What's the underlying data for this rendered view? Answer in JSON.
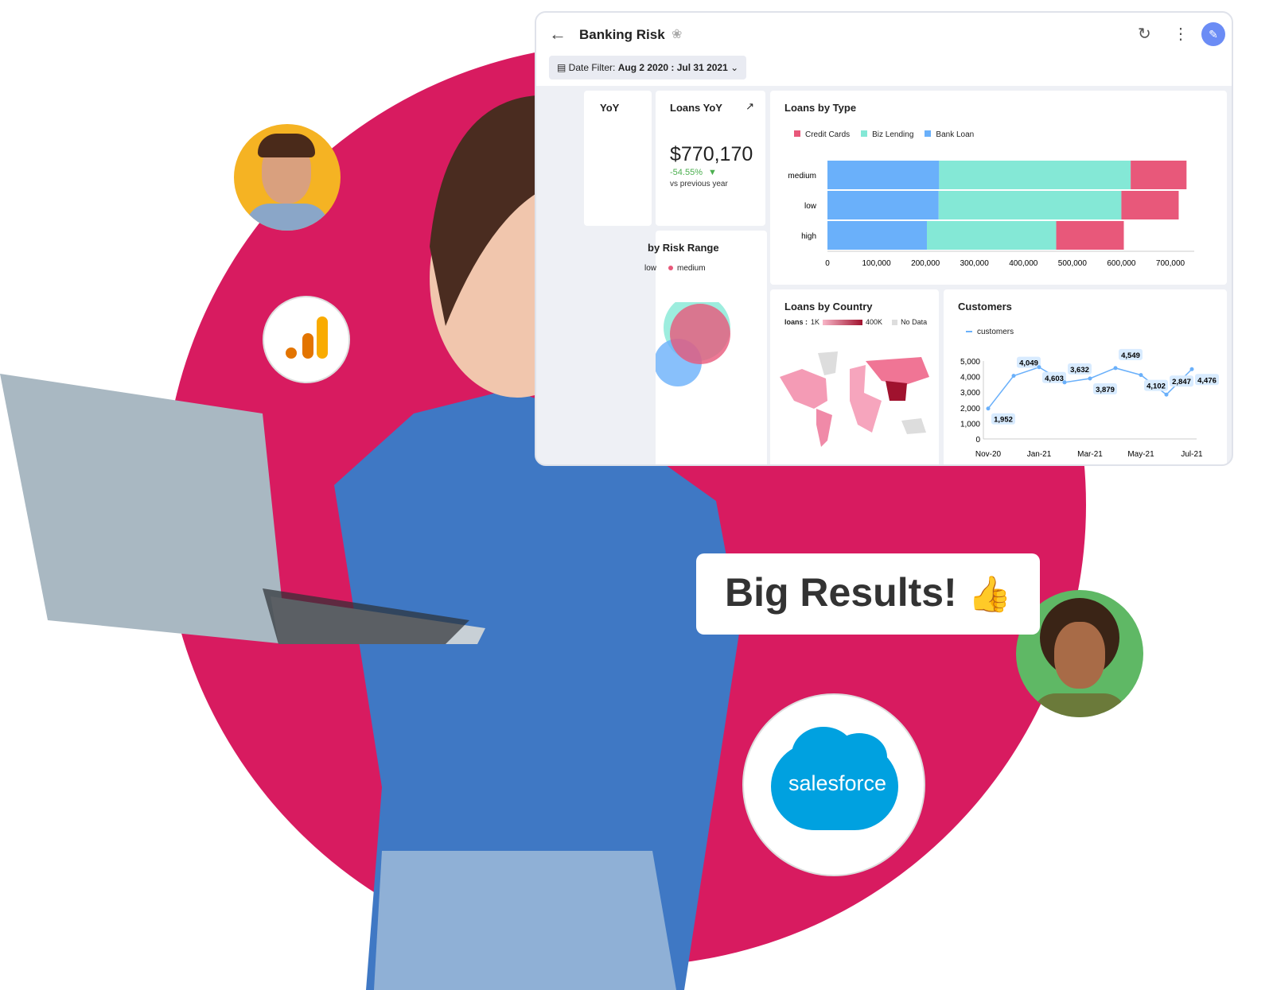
{
  "dashboard": {
    "title": "Banking Risk",
    "filter_label": "Date Filter:",
    "filter_value": "Aug 2 2020 : Jul 31 2021",
    "icons": [
      "back-arrow-icon",
      "badge-icon",
      "refresh-icon",
      "more-vert-icon",
      "edit-pencil-icon"
    ],
    "partial_card_title": "YoY",
    "loans_yoy": {
      "title": "Loans YoY",
      "value": "$770,170",
      "change": "-54.55%",
      "change_color": "#4caf50",
      "caption": "vs previous year"
    },
    "risk_range": {
      "title": "by Risk Range",
      "legend": [
        "low",
        "medium"
      ]
    },
    "map": {
      "title": "Loans by Country",
      "legend_label": "loans :",
      "min": "1K",
      "max": "400K",
      "no_data": "No Data"
    }
  },
  "chart_data": [
    {
      "type": "bar",
      "orientation": "horizontal",
      "stacked": true,
      "title": "Loans by Type",
      "categories": [
        "medium",
        "low",
        "high"
      ],
      "series": [
        {
          "name": "Bank Loan",
          "color": "#6ab0fa",
          "values": [
            228000,
            227000,
            203000
          ]
        },
        {
          "name": "Biz Lending",
          "color": "#84e8d6",
          "values": [
            391000,
            373000,
            264000
          ]
        },
        {
          "name": "Credit Cards",
          "color": "#e8587a",
          "values": [
            114000,
            117000,
            138000
          ]
        }
      ],
      "legend_order": [
        "Credit Cards",
        "Biz Lending",
        "Bank Loan"
      ],
      "xticks": [
        "0",
        "100,000",
        "200,000",
        "300,000",
        "400,000",
        "500,000",
        "600,000",
        "700,000"
      ],
      "xlim": [
        0,
        700000
      ]
    },
    {
      "type": "line",
      "title": "Customers",
      "series": [
        {
          "name": "customers",
          "color": "#6ab0fa",
          "values": [
            1952,
            4049,
            4603,
            3632,
            3879,
            4549,
            4102,
            2847,
            4476
          ]
        }
      ],
      "data_labels": [
        "1,952",
        "4,049",
        "4,603",
        "3,632",
        "3,879",
        "4,549",
        "4,102",
        "2,847",
        "4,476"
      ],
      "xticks": [
        "Nov-20",
        "Jan-21",
        "Mar-21",
        "May-21",
        "Jul-21"
      ],
      "yticks": [
        "0",
        "1,000",
        "2,000",
        "3,000",
        "4,000",
        "5,000"
      ],
      "ylim": [
        0,
        5000
      ]
    }
  ],
  "banner": {
    "text": "Big Results!",
    "icon": "thumbs-up-icon"
  },
  "logos": {
    "salesforce": "salesforce",
    "analytics": "google-analytics-icon"
  },
  "colors": {
    "brand": "#d81b60"
  }
}
